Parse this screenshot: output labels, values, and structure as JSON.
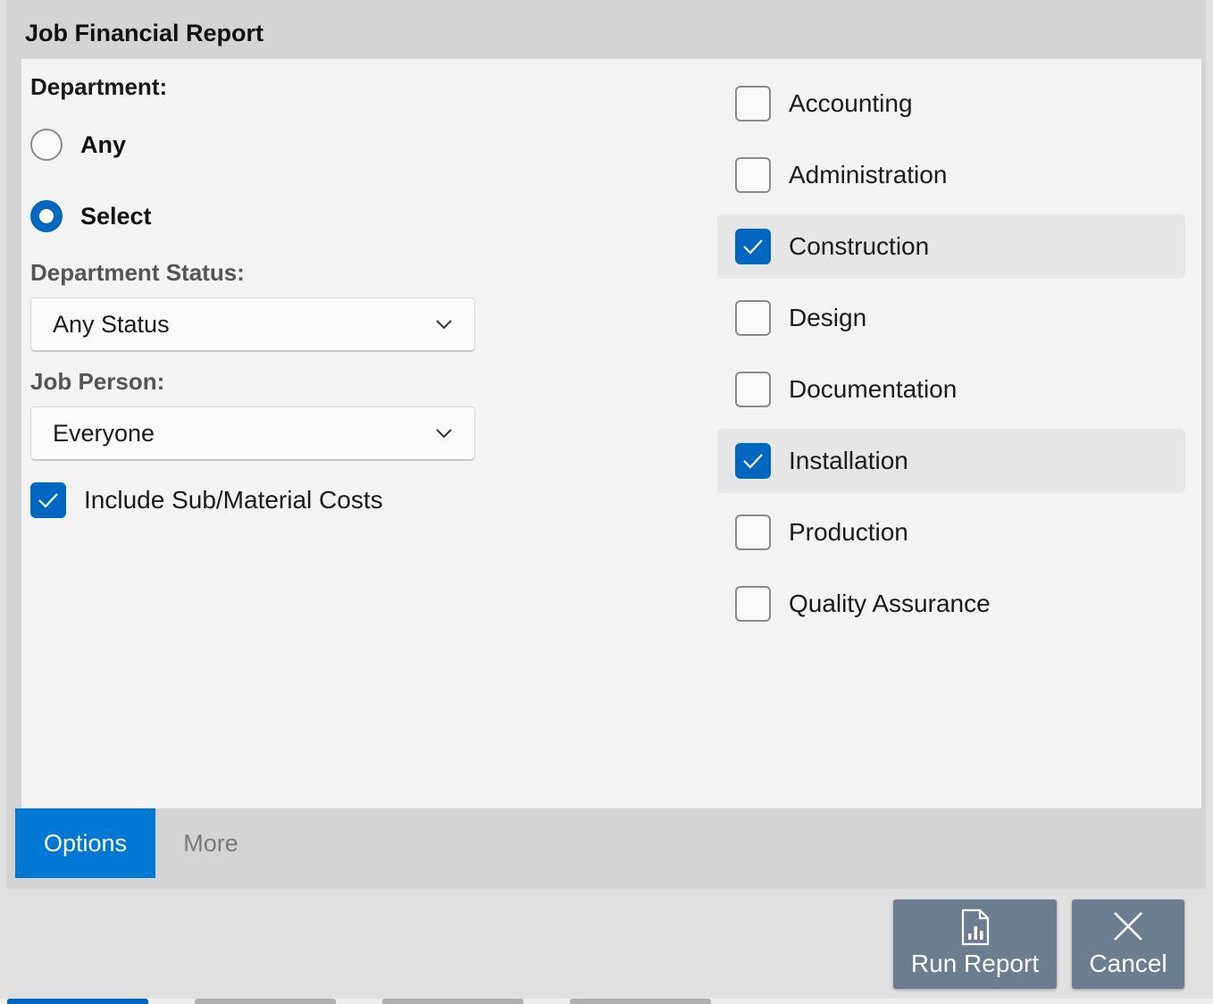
{
  "window": {
    "title": "Job Financial Report"
  },
  "department": {
    "label": "Department:",
    "options": [
      {
        "label": "Any",
        "selected": false
      },
      {
        "label": "Select",
        "selected": true
      }
    ]
  },
  "department_status": {
    "label": "Department Status:",
    "value": "Any Status"
  },
  "job_person": {
    "label": "Job Person:",
    "value": "Everyone"
  },
  "include_costs": {
    "label": "Include Sub/Material Costs",
    "checked": true
  },
  "departments": [
    {
      "label": "Accounting",
      "checked": false
    },
    {
      "label": "Administration",
      "checked": false
    },
    {
      "label": "Construction",
      "checked": true
    },
    {
      "label": "Design",
      "checked": false
    },
    {
      "label": "Documentation",
      "checked": false
    },
    {
      "label": "Installation",
      "checked": true
    },
    {
      "label": "Production",
      "checked": false
    },
    {
      "label": "Quality Assurance",
      "checked": false
    }
  ],
  "tabs": [
    {
      "label": "Options",
      "active": true
    },
    {
      "label": "More",
      "active": false
    }
  ],
  "buttons": {
    "run": {
      "label": "Run Report",
      "icon": "report-chart-icon"
    },
    "cancel": {
      "label": "Cancel",
      "icon": "close-icon"
    }
  },
  "colors": {
    "accent": "#0067c0",
    "tab_active": "#0078d4",
    "button": "#6d7d90"
  }
}
